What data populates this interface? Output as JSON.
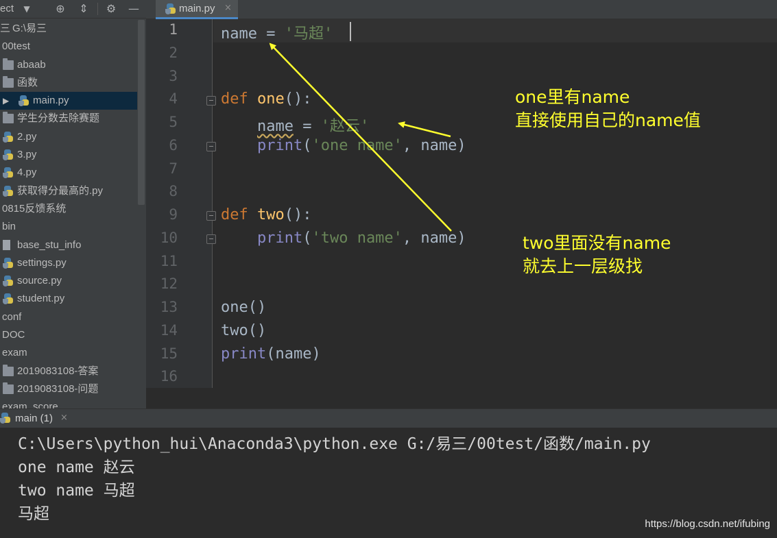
{
  "project_panel": {
    "title": "ect",
    "toolbar_icons": [
      "chevron-down-icon",
      "crosshair-icon",
      "collapse-icon",
      "gear-icon",
      "minus-icon"
    ],
    "tree": [
      {
        "label": "G:\\易三",
        "icon": "none",
        "prefix": "三"
      },
      {
        "label": "00test",
        "icon": "none"
      },
      {
        "label": "abaab",
        "icon": "folder-icon"
      },
      {
        "label": "函数",
        "icon": "folder-icon"
      },
      {
        "label": "main.py",
        "icon": "python-file-icon",
        "selected": true
      },
      {
        "label": "学生分数去除赛题",
        "icon": "folder-icon"
      },
      {
        "label": "2.py",
        "icon": "python-file-icon"
      },
      {
        "label": "3.py",
        "icon": "python-file-icon"
      },
      {
        "label": "4.py",
        "icon": "python-file-icon"
      },
      {
        "label": "获取得分最高的.py",
        "icon": "python-file-icon"
      },
      {
        "label": "0815反馈系统",
        "icon": "none"
      },
      {
        "label": "bin",
        "icon": "none"
      },
      {
        "label": "base_stu_info",
        "icon": "file-icon"
      },
      {
        "label": "settings.py",
        "icon": "python-file-icon"
      },
      {
        "label": "source.py",
        "icon": "python-file-icon"
      },
      {
        "label": "student.py",
        "icon": "python-file-icon"
      },
      {
        "label": "conf",
        "icon": "none"
      },
      {
        "label": "DOC",
        "icon": "none"
      },
      {
        "label": "exam",
        "icon": "none"
      },
      {
        "label": "2019083108-答案",
        "icon": "folder-icon"
      },
      {
        "label": "2019083108-问题",
        "icon": "folder-icon"
      },
      {
        "label": "exam_score",
        "icon": "none"
      }
    ]
  },
  "editor": {
    "tab": {
      "label": "main.py",
      "close": "×"
    },
    "line_numbers": [
      "1",
      "2",
      "3",
      "4",
      "5",
      "6",
      "7",
      "8",
      "9",
      "10",
      "11",
      "12",
      "13",
      "14",
      "15",
      "16"
    ],
    "code": {
      "l1": {
        "a": "name",
        "b": " = ",
        "c": "'马超'"
      },
      "l4": {
        "kw": "def",
        "sp": " ",
        "fn": "one",
        "rest": "():"
      },
      "l5": {
        "indent": "    ",
        "a": "name",
        "b": " = ",
        "c": "'赵云'"
      },
      "l6": {
        "indent": "    ",
        "bi": "print",
        "p1": "(",
        "s": "'one name'",
        "p2": ", name)"
      },
      "l9": {
        "kw": "def",
        "sp": " ",
        "fn": "two",
        "rest": "():"
      },
      "l10": {
        "indent": "    ",
        "bi": "print",
        "p1": "(",
        "s": "'two name'",
        "p2": ", name)"
      },
      "l13": "one()",
      "l14": "two()",
      "l15": {
        "bi": "print",
        "rest": "(name)"
      }
    }
  },
  "run_panel": {
    "tab": {
      "label": "main (1)",
      "close": "×"
    },
    "output": [
      "C:\\Users\\python_hui\\Anaconda3\\python.exe G:/易三/00test/函数/main.py",
      "one name 赵云",
      "two name 马超",
      "马超"
    ]
  },
  "annotations": {
    "note1": {
      "line1": "one里有name",
      "line2": "直接使用自己的name值"
    },
    "note2": {
      "line1": "two里面没有name",
      "line2": "就去上一层级找"
    },
    "arrow_color": "#ffff2e"
  },
  "watermark": "https://blog.csdn.net/ifubing"
}
